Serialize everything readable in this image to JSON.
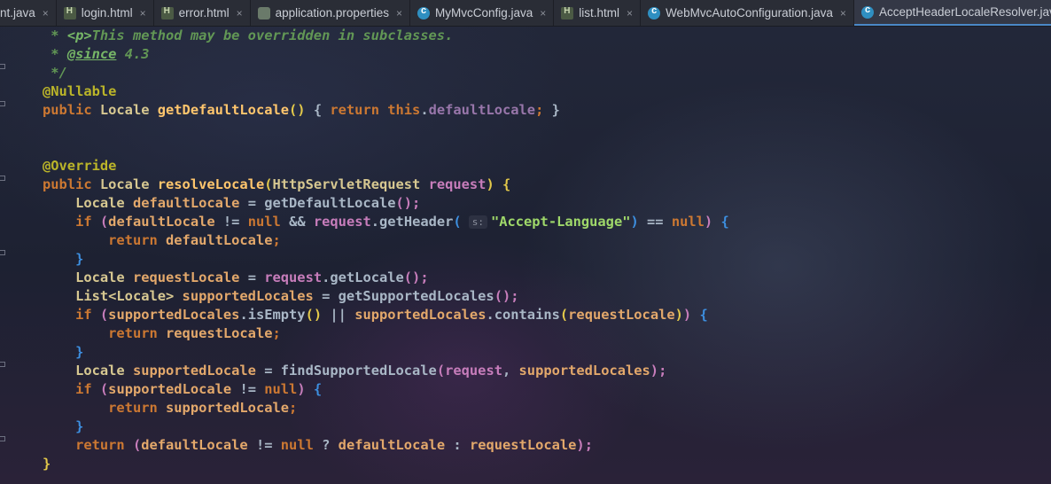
{
  "tabs": [
    {
      "label": "nt.java",
      "icon": "java-file-icon",
      "active": false
    },
    {
      "label": "login.html",
      "icon": "html-file-icon",
      "active": false
    },
    {
      "label": "error.html",
      "icon": "html-file-icon",
      "active": false
    },
    {
      "label": "application.properties",
      "icon": "properties-file-icon",
      "active": false
    },
    {
      "label": "MyMvcConfig.java",
      "icon": "class-file-icon",
      "active": false
    },
    {
      "label": "list.html",
      "icon": "html-file-icon",
      "active": false
    },
    {
      "label": "WebMvcAutoConfiguration.java",
      "icon": "class-file-icon",
      "active": false
    },
    {
      "label": "AcceptHeaderLocaleResolver.java",
      "icon": "class-file-icon",
      "active": true
    }
  ],
  "close_glyph": "×",
  "code": {
    "l1_star": " * ",
    "l1_p": "<p>",
    "l1_text": "This method may be overridden in subclasses.",
    "l2_star": " * ",
    "l2_since": "@since",
    "l2_ver": " 4.3",
    "l3": " */",
    "l4": "@Nullable",
    "l5_public": "public ",
    "l5_type": "Locale ",
    "l5_fn": "getDefaultLocale",
    "l5_paren": "() ",
    "l5_ob": "{ ",
    "l5_ret": "return ",
    "l5_this": "this",
    "l5_dot": ".",
    "l5_field": "defaultLocale",
    "l5_semi": "; ",
    "l5_cb": "}",
    "l8": "@Override",
    "l9_public": "public ",
    "l9_type": "Locale ",
    "l9_fn": "resolveLocale",
    "l9_op": "(",
    "l9_ptype": "HttpServletRequest ",
    "l9_param": "request",
    "l9_cp": ") ",
    "l9_ob": "{",
    "l10_type": "Locale ",
    "l10_var": "defaultLocale",
    "l10_eq": " = ",
    "l10_call": "getDefaultLocale",
    "l10_end": "();",
    "l11_if": "if ",
    "l11_op": "(",
    "l11_var": "defaultLocale",
    "l11_neq": " != ",
    "l11_null": "null",
    "l11_and": " && ",
    "l11_req": "request",
    "l11_dot": ".getHeader",
    "l11_po": "(",
    "l11_hint": "s:",
    "l11_str": "\"Accept-Language\"",
    "l11_pc": ")",
    "l11_eqeq": " == ",
    "l11_null2": "null",
    "l11_cp": ") ",
    "l11_ob": "{",
    "l12_ret": "return ",
    "l12_var": "defaultLocale",
    "l12_semi": ";",
    "l13": "}",
    "l14_type": "Locale ",
    "l14_var": "requestLocale",
    "l14_eq": " = ",
    "l14_req": "request",
    "l14_call": ".getLocale",
    "l14_end": "();",
    "l15_type": "List<Locale> ",
    "l15_var": "supportedLocales",
    "l15_eq": " = ",
    "l15_call": "getSupportedLocales",
    "l15_end": "();",
    "l16_if": "if ",
    "l16_op": "(",
    "l16_var": "supportedLocales",
    "l16_call": ".isEmpty",
    "l16_pp": "()",
    "l16_or": " || ",
    "l16_var2": "supportedLocales",
    "l16_call2": ".contains",
    "l16_po": "(",
    "l16_arg": "requestLocale",
    "l16_pc": ")",
    "l16_cp": ") ",
    "l16_ob": "{",
    "l17_ret": "return ",
    "l17_var": "requestLocale",
    "l17_semi": ";",
    "l18": "}",
    "l19_type": "Locale ",
    "l19_var": "supportedLocale",
    "l19_eq": " = ",
    "l19_call": "findSupportedLocale",
    "l19_po": "(",
    "l19_a1": "request",
    "l19_comma": ", ",
    "l19_a2": "supportedLocales",
    "l19_end": ");",
    "l20_if": "if ",
    "l20_op": "(",
    "l20_var": "supportedLocale",
    "l20_neq": " != ",
    "l20_null": "null",
    "l20_cp": ") ",
    "l20_ob": "{",
    "l21_ret": "return ",
    "l21_var": "supportedLocale",
    "l21_semi": ";",
    "l22": "}",
    "l23_ret": "return ",
    "l23_op": "(",
    "l23_var": "defaultLocale",
    "l23_neq": " != ",
    "l23_null": "null",
    "l23_q": " ? ",
    "l23_v2": "defaultLocale",
    "l23_colon": " : ",
    "l23_v3": "requestLocale",
    "l23_end": ");",
    "l24": "}"
  }
}
